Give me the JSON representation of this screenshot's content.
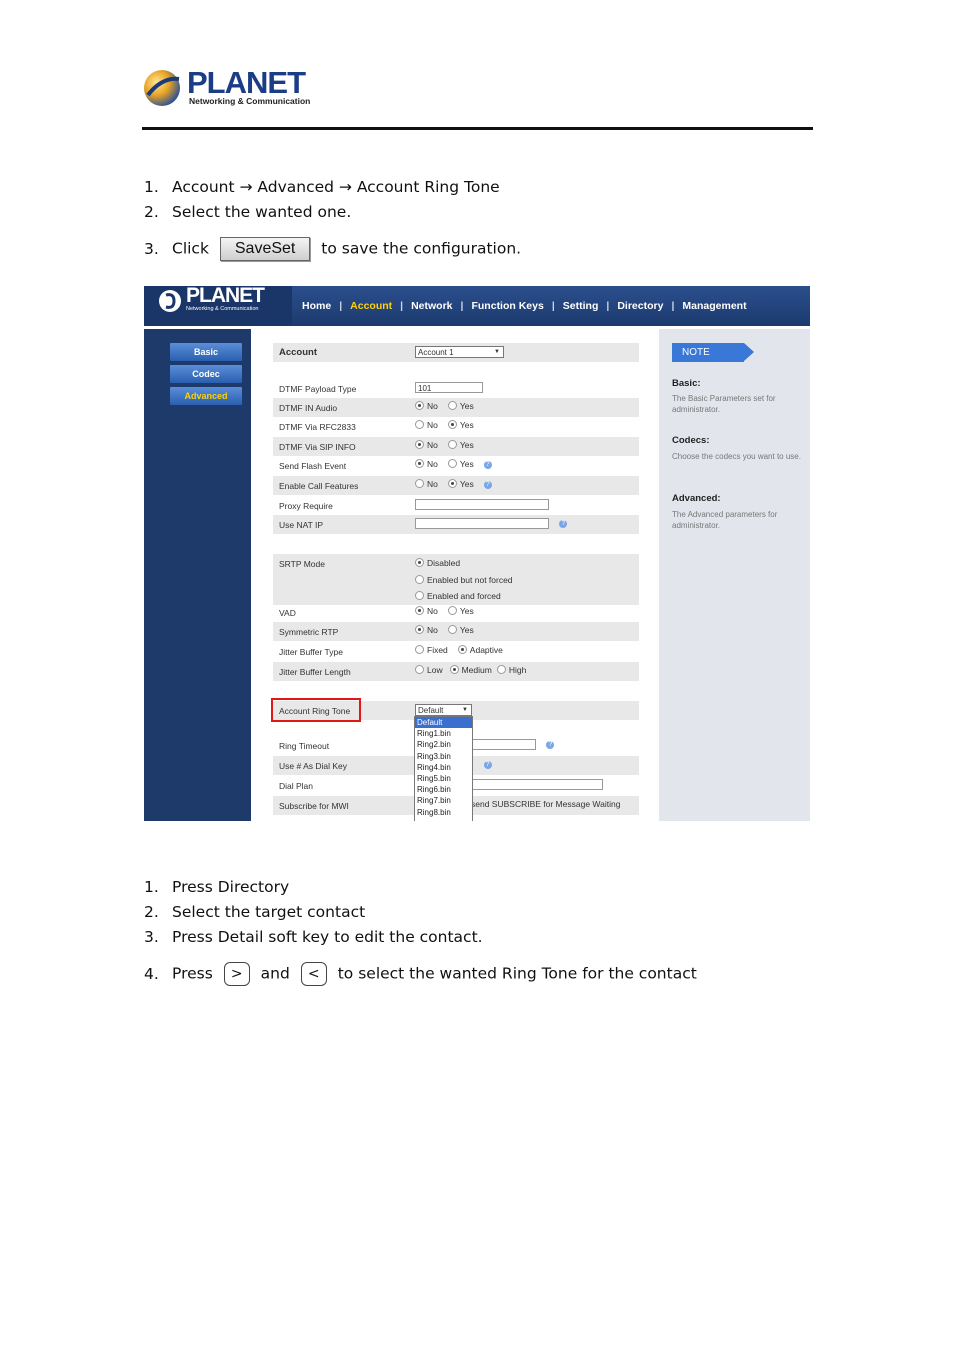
{
  "header": {
    "brand": "PLANET",
    "tagline": "Networking & Communication"
  },
  "steps_top": [
    {
      "num": "1.",
      "text": "Account → Advanced → Account Ring Tone"
    },
    {
      "num": "2.",
      "text": "Select the wanted one."
    }
  ],
  "step3": {
    "num": "3.",
    "pre": "Click",
    "button": "SaveSet",
    "post": "to save the configuration."
  },
  "shot": {
    "logo": "PLANET",
    "logo_tag": "Networking & Communication",
    "nav": [
      "Home",
      "Account",
      "Network",
      "Function Keys",
      "Setting",
      "Directory",
      "Management"
    ],
    "left_buttons": [
      "Basic",
      "Codec",
      "Advanced"
    ],
    "rows": {
      "account": {
        "label": "Account",
        "value": "Account 1"
      },
      "dtmf_payload": {
        "label": "DTMF Payload Type",
        "value": "101"
      },
      "dtmf_in_audio": {
        "label": "DTMF IN Audio"
      },
      "dtmf_rfc": {
        "label": "DTMF Via RFC2833"
      },
      "dtmf_sip": {
        "label": "DTMF Via SIP INFO"
      },
      "flash": {
        "label": "Send Flash Event"
      },
      "call_features": {
        "label": "Enable Call Features"
      },
      "proxy": {
        "label": "Proxy Require"
      },
      "nat": {
        "label": "Use NAT IP"
      },
      "srtp": {
        "label": "SRTP Mode",
        "o1": "Disabled",
        "o2": "Enabled but not forced",
        "o3": "Enabled and forced"
      },
      "vad": {
        "label": "VAD"
      },
      "srtp_sym": {
        "label": "Symmetric RTP"
      },
      "jitter_type": {
        "label": "Jitter Buffer Type",
        "o1": "Fixed",
        "o2": "Adaptive"
      },
      "jitter_len": {
        "label": "Jitter Buffer Length",
        "o1": "Low",
        "o2": "Medium",
        "o3": "High"
      },
      "ring_tone": {
        "label": "Account Ring Tone",
        "value": "Default"
      },
      "ring_timeout": {
        "label": "Ring Timeout"
      },
      "dial_key": {
        "label": "Use # As Dial Key",
        "frag": "s"
      },
      "dial_plan": {
        "label": "Dial Plan"
      },
      "mwi": {
        "label": "Subscribe for MWI",
        "text": "send SUBSCRIBE for Message Waiting"
      }
    },
    "no": "No",
    "yes": "Yes",
    "dropdown": [
      "Default",
      "Ring1.bin",
      "Ring2.bin",
      "Ring3.bin",
      "Ring4.bin",
      "Ring5.bin",
      "Ring6.bin",
      "Ring7.bin",
      "Ring8.bin"
    ],
    "note": {
      "tab": "NOTE",
      "basic_h": "Basic:",
      "basic_p": "The Basic Parameters set for administrator.",
      "codecs_h": "Codecs:",
      "codecs_p": "Choose the codecs you want to use.",
      "adv_h": "Advanced:",
      "adv_p": "The Advanced parameters for administrator."
    }
  },
  "steps_bottom": [
    {
      "num": "1.",
      "text": "Press Directory"
    },
    {
      "num": "2.",
      "text": "Select the target contact"
    },
    {
      "num": "3.",
      "text": "Press Detail soft key to edit the contact."
    }
  ],
  "step4": {
    "num": "4.",
    "pre": "Press",
    "mid": "and",
    "post": "to select the wanted Ring Tone for the contact",
    "key_right": ">",
    "key_left": "<"
  }
}
